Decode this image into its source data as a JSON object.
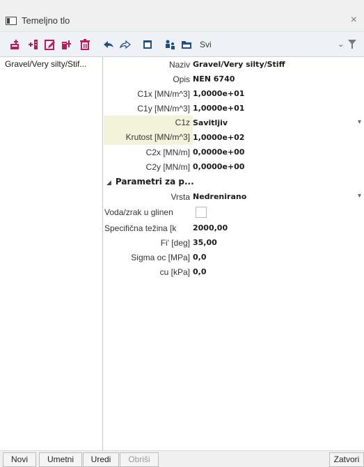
{
  "window": {
    "title": "Temeljno tlo",
    "close_glyph": "×"
  },
  "toolbar": {
    "icons": [
      "new-icon",
      "insert-icon",
      "edit-icon",
      "copy-icon",
      "delete-icon",
      "undo-icon",
      "redo-icon",
      "bin-icon",
      "users-icon",
      "save-icon",
      "filter-icon"
    ],
    "filter_value": "Svi",
    "accent": "#c2185b",
    "blue": "#1f4f8a"
  },
  "left_list": {
    "items": [
      "Gravel/Very silty/Stif..."
    ]
  },
  "properties": {
    "rows": [
      {
        "label": "Naziv",
        "value": "Gravel/Very silty/Stiff"
      },
      {
        "label": "Opis",
        "value": "NEN 6740"
      },
      {
        "label": "C1x [MN/m^3]",
        "value": "1,0000e+01"
      },
      {
        "label": "C1y [MN/m^3]",
        "value": "1,0000e+01"
      },
      {
        "label": "C1z",
        "value": "Savitljiv"
      },
      {
        "label": "Krutost [MN/m^3]",
        "value": "1,0000e+02"
      },
      {
        "label": "C2x [MN/m]",
        "value": "0,0000e+00"
      },
      {
        "label": "C2y [MN/m]",
        "value": "0,0000e+00"
      }
    ],
    "section": {
      "label": "Parametri za p..."
    },
    "section_rows": [
      {
        "label": "Vrsta",
        "value": "Nedrenirano"
      },
      {
        "label": "Voda/zrak u glinen",
        "value": ""
      },
      {
        "label": "Specifična težina [k",
        "value": "2000,00"
      },
      {
        "label": "Fi' [deg]",
        "value": "35,00"
      },
      {
        "label": "Sigma oc [MPa]",
        "value": "0,0"
      },
      {
        "label": "cu [kPa]",
        "value": "0,0"
      }
    ]
  },
  "buttons": {
    "new": "Novi",
    "insert": "Umetni",
    "edit": "Uredi",
    "delete": "Obriši",
    "close": "Zatvori"
  }
}
